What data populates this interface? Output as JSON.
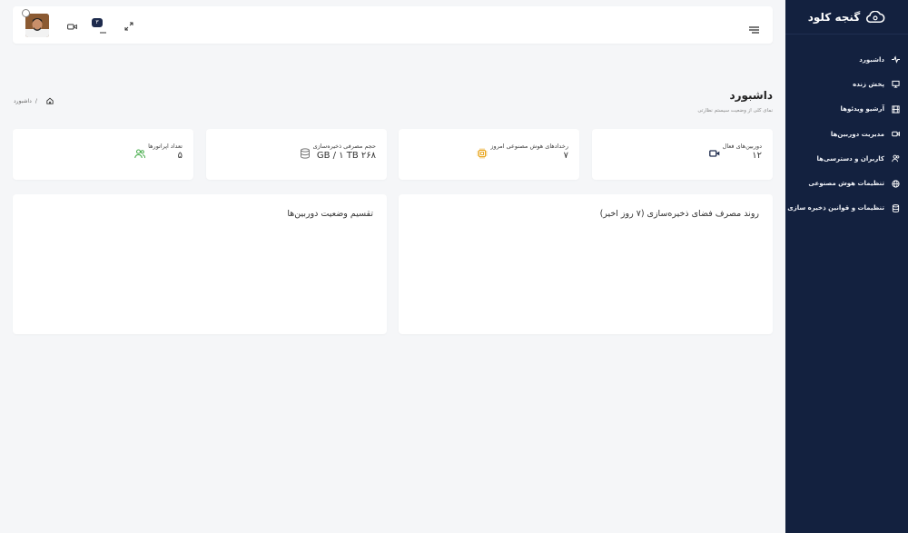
{
  "brand": {
    "name": "گنجه کلود"
  },
  "sidebar": {
    "items": [
      {
        "label": "داشبورد",
        "icon": "activity-icon"
      },
      {
        "label": "پخش زنده",
        "icon": "monitor-icon"
      },
      {
        "label": "آرشیو ویدئوها",
        "icon": "film-icon"
      },
      {
        "label": "مدیریت دوربین‌ها",
        "icon": "video-icon"
      },
      {
        "label": "کاربران و دسترسی‌ها",
        "icon": "users-icon"
      },
      {
        "label": "تنظیمات هوش مصنوعی",
        "icon": "globe-icon"
      },
      {
        "label": "تنظیمات و قوانین ذخیره سازی",
        "icon": "database-icon"
      }
    ]
  },
  "header": {
    "notification_count": "۳"
  },
  "page": {
    "title": "داشبورد",
    "subtitle": "نمای کلی از وضعیت سیستم نظارتی",
    "breadcrumb": {
      "current": "داشبورد",
      "separator": "/"
    }
  },
  "stats": [
    {
      "label": "دوربین‌های فعال",
      "value": "۱۲",
      "icon": "video-icon",
      "color": "#1e2b4d"
    },
    {
      "label": "رخدادهای هوش مصنوعی امروز",
      "value": "۷",
      "icon": "cpu-icon",
      "color": "#e8a317"
    },
    {
      "label": "حجم مصرفی ذخیره‌سازی",
      "value": "GB / ۱ TB ۲۶۸",
      "icon": "database-icon",
      "color": "#777777"
    },
    {
      "label": "تعداد اپراتورها",
      "value": "۵",
      "icon": "users-icon",
      "color": "#4caf50"
    }
  ],
  "charts": {
    "storage_title": "روند مصرف فضای ذخیره‌سازی (۷ روز اخیر)",
    "camera_status_title": "تقسیم وضعیت دوربین‌ها"
  }
}
